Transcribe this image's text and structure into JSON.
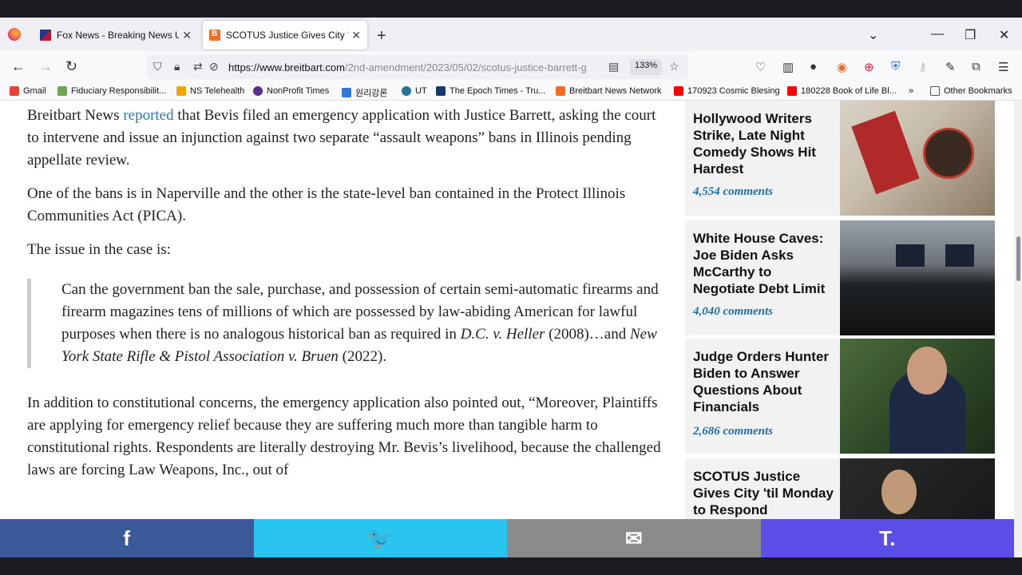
{
  "tabs": [
    {
      "title": "Fox News - Breaking News Upd",
      "active": false
    },
    {
      "title": "SCOTUS Justice Gives City 'til M",
      "active": true
    }
  ],
  "nav": {
    "url_domain": "https://www.breitbart.com",
    "url_path": "/2nd-amendment/2023/05/02/scotus-justice-barrett-g",
    "zoom": "133%"
  },
  "bookmarks": [
    {
      "label": "Gmail",
      "color": "#ea4335"
    },
    {
      "label": "Fiduciary Responsibilit...",
      "color": "#6aa84f"
    },
    {
      "label": "NS Telehealth",
      "color": "#f4a300"
    },
    {
      "label": "NonProfit Times",
      "color": "#5b2d8e"
    },
    {
      "label": "원리강론",
      "color": "#2e7bd6"
    },
    {
      "label": "UT",
      "color": "#21759b"
    },
    {
      "label": "The Epoch Times - Tru...",
      "color": "#1a3a6b"
    },
    {
      "label": "Breitbart News Network",
      "color": "#f26c22"
    },
    {
      "label": "170923 Cosmic Blesing",
      "color": "#ff0000"
    },
    {
      "label": "180228 Book of Life Bl...",
      "color": "#ff0000"
    },
    {
      "label": "Other Bookmarks",
      "color": "#555555"
    }
  ],
  "article": {
    "p1_pre": "Breitbart News ",
    "p1_link": "reported",
    "p1_post": " that Bevis filed an emergency application with Justice Barrett, asking the court to intervene and issue an injunction against two separate “assault weapons” bans in Illinois pending appellate review.",
    "p2": "One of the bans is in Naperville and the other is the state-level ban contained in the Protect Illinois Communities Act (PICA).",
    "p3": "The issue in the case is:",
    "quote_pre": "Can the government ban the sale, purchase, and possession of certain semi-automatic firearms and firearm magazines tens of millions of which are possessed by law-abiding American for lawful purposes when there is no analogous historical ban as required in ",
    "quote_case1": "D.C. v. Heller",
    "quote_mid": " (2008)…and ",
    "quote_case2": "New York State Rifle & Pistol Association v. Bruen",
    "quote_post": " (2022).",
    "p4": "In addition to constitutional concerns, the emergency application also pointed out, “Moreover, Plaintiffs are applying for emergency relief because they are suffering much more than tangible harm to constitutional rights. Respondents are literally destroying Mr. Bevis’s livelihood, because the challenged laws are forcing Law Weapons, Inc., out of"
  },
  "sidebar": [
    {
      "title": "Hollywood Writers Strike, Late Night Comedy Shows Hit Hardest",
      "comments": "4,554 comments"
    },
    {
      "title": "White House Caves: Joe Biden Asks McCarthy to Negotiate Debt Limit",
      "comments": "4,040 comments"
    },
    {
      "title": "Judge Orders Hunter Biden to Answer Questions About Financials",
      "comments": "2,686 comments"
    },
    {
      "title": "SCOTUS Justice Gives City 'til Monday to Respond",
      "comments": ""
    }
  ],
  "share": {
    "facebook": "f",
    "twitter": "🐦",
    "email": "✉",
    "truth": "T."
  }
}
